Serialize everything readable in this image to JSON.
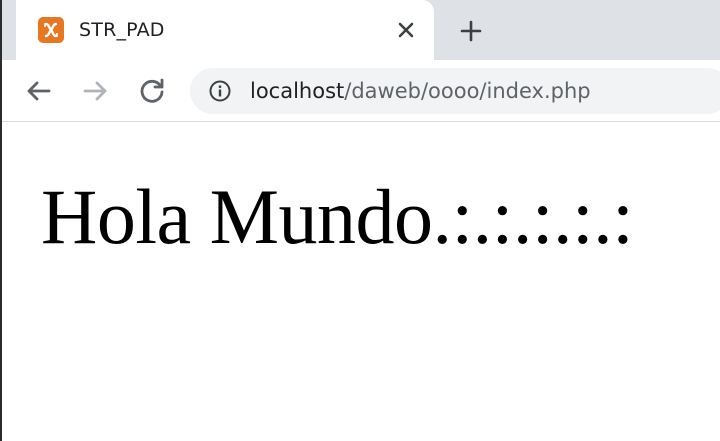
{
  "browser": {
    "tab": {
      "title": "STR_PAD",
      "favicon": "xampp-icon",
      "favicon_color": "#E87722"
    },
    "new_tab_icon": "plus-icon",
    "nav": {
      "back_icon": "arrow-left-icon",
      "forward_icon": "arrow-right-icon",
      "reload_icon": "reload-icon"
    },
    "address_bar": {
      "info_icon": "info-icon",
      "host": "localhost",
      "path": "/daweb/oooo/index.php"
    },
    "colors": {
      "tab_strip_bg": "#DEE1E6",
      "omnibox_bg": "#F1F3F4",
      "text_primary": "#202124",
      "text_secondary": "#5F6368"
    }
  },
  "page": {
    "text": "Hola Mundo.:.:.:.:.:"
  }
}
